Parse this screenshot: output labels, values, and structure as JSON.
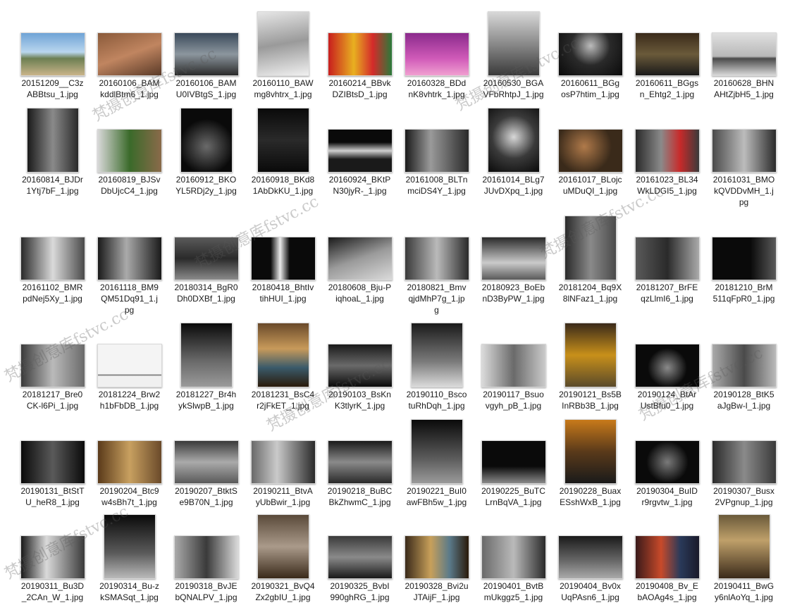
{
  "files": [
    {
      "name": "20151209__C3zABBtsu_1.jpg",
      "l1": "20151209__C3z",
      "l2": "ABBtsu_1.jpg",
      "shape": "land",
      "bg": "linear-gradient(180deg,#6fa3d6 0%,#b9d6ee 45%,#6c7f52 60%,#c9b48a 100%)"
    },
    {
      "name": "20160106_BAMkddlBtm6_1.jpg",
      "l1": "20160106_BAM",
      "l2": "kddlBtm6_1.jpg",
      "shape": "land",
      "bg": "linear-gradient(160deg,#8a5a3a,#c08560 50%,#5a3a28)"
    },
    {
      "name": "20160106_BAMU0IVBtgS_1.jpg",
      "l1": "20160106_BAM",
      "l2": "U0IVBtgS_1.jpg",
      "shape": "land",
      "bg": "linear-gradient(180deg,#3a4a5a,#8c969e 50%,#2a2a2a)"
    },
    {
      "name": "20160110_BAWmg8vhtrx_1.jpg",
      "l1": "20160110_BAW",
      "l2": "mg8vhtrx_1.jpg",
      "shape": "square",
      "bg": "linear-gradient(170deg,#e6e6e6,#9a9a9a 50%,#f0f0f0)"
    },
    {
      "name": "20160214_BBvkDZIBtsD_1.jpg",
      "l1": "20160214_BBvk",
      "l2": "DZIBtsD_1.jpg",
      "shape": "land",
      "bg": "linear-gradient(90deg,#c81e1e,#e8b020 40%,#d42a2a 70%,#2a7a3a)"
    },
    {
      "name": "20160328_BDdnK8vhtrk_1.jpg",
      "l1": "20160328_BDd",
      "l2": "nK8vhtrk_1.jpg",
      "shape": "land",
      "bg": "linear-gradient(180deg,#8a2a8c,#d05ab8 60%,#f0a0d0)"
    },
    {
      "name": "20160530_BGAVFbRhtpJ_1.jpg",
      "l1": "20160530_BGA",
      "l2": "VFbRhtpJ_1.jpg",
      "shape": "square",
      "bg": "linear-gradient(180deg,#d8d8d8,#8a8a8a 50%,#3a3a3a)"
    },
    {
      "name": "20160611_BGgosP7htim_1.jpg",
      "l1": "20160611_BGg",
      "l2": "osP7htim_1.jpg",
      "shape": "land",
      "bg": "radial-gradient(circle at 50% 30%,#bcbcbc,#2a2a2a 45%,#0a0a0a)"
    },
    {
      "name": "20160611_BGgsn_Ehtg2_1.jpg",
      "l1": "20160611_BGgs",
      "l2": "n_Ehtg2_1.jpg",
      "shape": "land",
      "bg": "linear-gradient(180deg,#3a2a1a,#6a5a3a 50%,#1a1a1a)"
    },
    {
      "name": "20160628_BHNAHtZjbH5_1.jpg",
      "l1": "20160628_BHN",
      "l2": "AHtZjbH5_1.jpg",
      "shape": "land",
      "bg": "linear-gradient(180deg,#e0e0e0,#b8b8b8 55%,#4a4a4a 60%,#d8d8d8)"
    },
    {
      "name": "20160814_BJDr1Ytj7bF_1.jpg",
      "l1": "20160814_BJDr",
      "l2": "1Ytj7bF_1.jpg",
      "shape": "port",
      "bg": "linear-gradient(90deg,#1a1a1a,#8a8a8a 50%,#2a2a2a)"
    },
    {
      "name": "20160819_BJSvDbUjcC4_1.jpg",
      "l1": "20160819_BJSv",
      "l2": "DbUjcC4_1.jpg",
      "shape": "land",
      "bg": "linear-gradient(90deg,#d8d8d8,#3a6a2a 50%,#8a6a4a)"
    },
    {
      "name": "20160912_BKOYL5RDj2y_1.jpg",
      "l1": "20160912_BKO",
      "l2": "YL5RDj2y_1.jpg",
      "shape": "square",
      "bg": "radial-gradient(circle at 50% 60%,#6a6a6a,#0a0a0a 60%)"
    },
    {
      "name": "20160918_BKd81AbDkKU_1.jpg",
      "l1": "20160918_BKd8",
      "l2": "1AbDkKU_1.jpg",
      "shape": "port",
      "bg": "linear-gradient(180deg,#0a0a0a,#2a2a2a 50%,#0a0a0a)"
    },
    {
      "name": "20160924_BKtPN30jyR-_1.jpg",
      "l1": "20160924_BKtP",
      "l2": "N30jyR-_1.jpg",
      "shape": "land",
      "bg": "linear-gradient(180deg,#0a0a0a 30%,#cfcfcf 50%,#1a1a1a 70%)"
    },
    {
      "name": "20161008_BLTnmciDS4Y_1.jpg",
      "l1": "20161008_BLTn",
      "l2": "mciDS4Y_1.jpg",
      "shape": "land",
      "bg": "linear-gradient(90deg,#1a1a1a,#9a9a9a 40%,#2a2a2a)"
    },
    {
      "name": "20161014_BLg7JUvDXpq_1.jpg",
      "l1": "20161014_BLg7",
      "l2": "JUvDXpq_1.jpg",
      "shape": "square",
      "bg": "radial-gradient(circle at 50% 45%,#d8d8d8,#3a3a3a 50%,#0a0a0a)"
    },
    {
      "name": "20161017_BLojcuMDuQI_1.jpg",
      "l1": "20161017_BLojc",
      "l2": "uMDuQI_1.jpg",
      "shape": "land",
      "bg": "radial-gradient(circle at 40% 40%,#b07a4a,#3a2a1a 60%)"
    },
    {
      "name": "20161023_BL34WkLDGI5_1.jpg",
      "l1": "20161023_BL34",
      "l2": "WkLDGI5_1.jpg",
      "shape": "land",
      "bg": "linear-gradient(90deg,#2a2a2a,#8a8a8a 40%,#c82a2a 70%,#3a3a3a)"
    },
    {
      "name": "20161031_BMOkQVDDvMH_1.jpg",
      "l1": "20161031_BMO",
      "l2": "kQVDDvMH_1.j",
      "l3": "pg",
      "shape": "land",
      "bg": "linear-gradient(90deg,#4a4a4a,#bcbcbc 50%,#2a2a2a)"
    },
    {
      "name": "20161102_BMRpdNej5Xy_1.jpg",
      "l1": "20161102_BMR",
      "l2": "pdNej5Xy_1.jpg",
      "shape": "land",
      "bg": "linear-gradient(90deg,#2a2a2a,#dadada 50%,#4a4a4a)"
    },
    {
      "name": "20161118_BM9QM51Dq91_1.jpg",
      "l1": "20161118_BM9",
      "l2": "QM51Dq91_1.j",
      "l3": "pg",
      "shape": "land",
      "bg": "linear-gradient(90deg,#1a1a1a,#aaaaaa 45%,#1a1a1a)"
    },
    {
      "name": "20180314_BgR0Dh0DXBf_1.jpg",
      "l1": "20180314_BgR0",
      "l2": "Dh0DXBf_1.jpg",
      "shape": "land",
      "bg": "linear-gradient(180deg,#5a5a5a,#2a2a2a 50%,#8a8a8a)"
    },
    {
      "name": "20180418_BhtIvtihHUI_1.jpg",
      "l1": "20180418_BhtIv",
      "l2": "tihHUI_1.jpg",
      "shape": "land",
      "bg": "linear-gradient(90deg,#0a0a0a 30%,#eaeaea 45%,#0a0a0a 60%)"
    },
    {
      "name": "20180608_Bju-PiqhoaL_1.jpg",
      "l1": "20180608_Bju-P",
      "l2": "iqhoaL_1.jpg",
      "shape": "land",
      "bg": "linear-gradient(160deg,#1a1a1a,#9a9a9a 50%,#dadada)"
    },
    {
      "name": "20180821_BmvqjdMhP7g_1.jpg",
      "l1": "20180821_Bmv",
      "l2": "qjdMhP7g_1.jp",
      "l3": "g",
      "shape": "land",
      "bg": "linear-gradient(90deg,#3a3a3a,#bababa 50%,#2a2a2a)"
    },
    {
      "name": "20180923_BoEbnD3ByPW_1.jpg",
      "l1": "20180923_BoEb",
      "l2": "nD3ByPW_1.jpg",
      "shape": "land",
      "bg": "linear-gradient(180deg,#2a2a2a,#cacaca 60%,#5a5a5a)"
    },
    {
      "name": "20181204_Bq9X8lNFaz1_1.jpg",
      "l1": "20181204_Bq9X",
      "l2": "8lNFaz1_1.jpg",
      "shape": "square",
      "bg": "linear-gradient(90deg,#2a2a2a,#8a8a8a 50%,#4a4a4a)"
    },
    {
      "name": "20181207_BrFEqzLlmI6_1.jpg",
      "l1": "20181207_BrFE",
      "l2": "qzLlmI6_1.jpg",
      "shape": "land",
      "bg": "linear-gradient(90deg,#5a5a5a,#2a2a2a 50%,#aaaaaa)"
    },
    {
      "name": "20181210_BrM511qFpR0_1.jpg",
      "l1": "20181210_BrM",
      "l2": "511qFpR0_1.jpg",
      "shape": "land",
      "bg": "linear-gradient(90deg,#0a0a0a 60%,#5a5a5a)"
    },
    {
      "name": "20181217_Bre0CK-l6Pi_1.jpg",
      "l1": "20181217_Bre0",
      "l2": "CK-l6Pi_1.jpg",
      "shape": "land",
      "bg": "linear-gradient(90deg,#3a3a3a,#bababa 50%,#6a6a6a)"
    },
    {
      "name": "20181224_Brw2h1bFbDB_1.jpg",
      "l1": "20181224_Brw2",
      "l2": "h1bFbDB_1.jpg",
      "shape": "land",
      "bg": "linear-gradient(180deg,#f4f4f4 70%,#6a6a6a 72%,#f0f0f0 75%)"
    },
    {
      "name": "20181227_Br4hykSlwpB_1.jpg",
      "l1": "20181227_Br4h",
      "l2": "ykSlwpB_1.jpg",
      "shape": "port",
      "bg": "linear-gradient(180deg,#0a0a0a,#6a6a6a 60%,#9a9a9a)"
    },
    {
      "name": "20181231_BsC4r2jFkET_1.jpg",
      "l1": "20181231_BsC4",
      "l2": "r2jFkET_1.jpg",
      "shape": "port",
      "bg": "linear-gradient(180deg,#6a4a2a,#c89a5a 40%,#3a5a6a 70%,#2a1a0a)"
    },
    {
      "name": "20190103_BsKnK3tlyrK_1.jpg",
      "l1": "20190103_BsKn",
      "l2": "K3tlyrK_1.jpg",
      "shape": "land",
      "bg": "linear-gradient(180deg,#1a1a1a,#6a6a6a 50%,#0a0a0a)"
    },
    {
      "name": "20190110_BscotuRhDqh_1.jpg",
      "l1": "20190110_Bsco",
      "l2": "tuRhDqh_1.jpg",
      "shape": "square",
      "bg": "linear-gradient(180deg,#1a1a1a,#7a7a7a 60%,#dadada)"
    },
    {
      "name": "20190117_Bsuovgyh_pB_1.jpg",
      "l1": "20190117_Bsuo",
      "l2": "vgyh_pB_1.jpg",
      "shape": "land",
      "bg": "linear-gradient(90deg,#dadada,#6a6a6a 50%,#cacaca)"
    },
    {
      "name": "20190121_Bs5BInRBb3B_1.jpg",
      "l1": "20190121_Bs5B",
      "l2": "InRBb3B_1.jpg",
      "shape": "port",
      "bg": "linear-gradient(180deg,#3a2a1a,#c8901a 50%,#5a4a2a)"
    },
    {
      "name": "20190124_BtArUstBfu0_1.jpg",
      "l1": "20190124_BtAr",
      "l2": "UstBfu0_1.jpg",
      "shape": "land",
      "bg": "radial-gradient(circle at 50% 55%,#8a8a8a,#0a0a0a 50%)"
    },
    {
      "name": "20190128_BtK5aJgBw-l_1.jpg",
      "l1": "20190128_BtK5",
      "l2": "aJgBw-l_1.jpg",
      "shape": "land",
      "bg": "linear-gradient(90deg,#aaaaaa,#4a4a4a 50%,#bababa)"
    },
    {
      "name": "20190131_BtStTU_heR8_1.jpg",
      "l1": "20190131_BtStT",
      "l2": "U_heR8_1.jpg",
      "shape": "land",
      "bg": "linear-gradient(90deg,#0a0a0a,#5a5a5a 50%,#0a0a0a)"
    },
    {
      "name": "20190204_Btc9w4sBh7t_1.jpg",
      "l1": "20190204_Btc9",
      "l2": "w4sBh7t_1.jpg",
      "shape": "land",
      "bg": "linear-gradient(90deg,#5a3a1a,#c8a060 50%,#6a4a2a)"
    },
    {
      "name": "20190207_BtktSe9B70N_1.jpg",
      "l1": "20190207_BtktS",
      "l2": "e9B70N_1.jpg",
      "shape": "land",
      "bg": "linear-gradient(180deg,#3a3a3a,#aaaaaa 50%,#5a5a5a)"
    },
    {
      "name": "20190211_BtvAyUbBwir_1.jpg",
      "l1": "20190211_BtvA",
      "l2": "yUbBwir_1.jpg",
      "shape": "land",
      "bg": "linear-gradient(90deg,#6a6a6a,#cacaca 40%,#2a2a2a)"
    },
    {
      "name": "20190218_BuBCBkZhwmC_1.jpg",
      "l1": "20190218_BuBC",
      "l2": "BkZhwmC_1.jpg",
      "shape": "land",
      "bg": "linear-gradient(180deg,#1a1a1a,#8a8a8a 50%,#2a2a2a)"
    },
    {
      "name": "20190221_BuI0awFBh5w_1.jpg",
      "l1": "20190221_BuI0",
      "l2": "awFBh5w_1.jpg",
      "shape": "square",
      "bg": "linear-gradient(180deg,#0a0a0a,#5a5a5a 60%,#9a9a9a)"
    },
    {
      "name": "20190225_BuTCLrnBqVA_1.jpg",
      "l1": "20190225_BuTC",
      "l2": "LrnBqVA_1.jpg",
      "shape": "land",
      "bg": "linear-gradient(180deg,#0a0a0a 60%,#8a8a8a)"
    },
    {
      "name": "20190228_BuaxESshWxB_1.jpg",
      "l1": "20190228_Buax",
      "l2": "ESshWxB_1.jpg",
      "shape": "port",
      "bg": "linear-gradient(180deg,#c87a1a,#5a3a1a 50%,#1a1a1a)"
    },
    {
      "name": "20190304_BuIDr9rgvtw_1.jpg",
      "l1": "20190304_BuID",
      "l2": "r9rgvtw_1.jpg",
      "shape": "land",
      "bg": "radial-gradient(circle at 50% 50%,#7a7a7a,#0a0a0a 55%)"
    },
    {
      "name": "20190307_Busx2VPgnup_1.jpg",
      "l1": "20190307_Busx",
      "l2": "2VPgnup_1.jpg",
      "shape": "land",
      "bg": "linear-gradient(90deg,#2a2a2a,#8a8a8a 50%,#3a3a3a)"
    },
    {
      "name": "20190311_Bu3D_2CAn_W_1.jpg",
      "l1": "20190311_Bu3D",
      "l2": "_2CAn_W_1.jpg",
      "shape": "land",
      "bg": "linear-gradient(90deg,#1a1a1a,#dadada 40%,#3a3a3a)"
    },
    {
      "name": "20190314_Bu-zkSMASqt_1.jpg",
      "l1": "20190314_Bu-z",
      "l2": "kSMASqt_1.jpg",
      "shape": "square",
      "bg": "linear-gradient(180deg,#0a0a0a,#5a5a5a 60%,#bababa)"
    },
    {
      "name": "20190318_BvJEbQNALPV_1.jpg",
      "l1": "20190318_BvJE",
      "l2": "bQNALPV_1.jpg",
      "shape": "land",
      "bg": "linear-gradient(90deg,#aaaaaa,#3a3a3a 50%,#dadada)"
    },
    {
      "name": "20190321_BvQ4Zx2gbIU_1.jpg",
      "l1": "20190321_BvQ4",
      "l2": "Zx2gbIU_1.jpg",
      "shape": "port",
      "bg": "linear-gradient(180deg,#5a4a3a,#aa9a8a 50%,#3a2a1a)"
    },
    {
      "name": "20190325_BvbI990ghRG_1.jpg",
      "l1": "20190325_BvbI",
      "l2": "990ghRG_1.jpg",
      "shape": "land",
      "bg": "linear-gradient(180deg,#3a3a3a,#8a8a8a 50%,#1a1a1a)"
    },
    {
      "name": "20190328_Bvi2uJTAijF_1.jpg",
      "l1": "20190328_Bvi2u",
      "l2": "JTAijF_1.jpg",
      "shape": "land",
      "bg": "linear-gradient(90deg,#3a2a1a,#c8a05a 40%,#5a7a8a 70%,#2a1a0a)"
    },
    {
      "name": "20190401_BvtBmUkggz5_1.jpg",
      "l1": "20190401_BvtB",
      "l2": "mUkggz5_1.jpg",
      "shape": "land",
      "bg": "linear-gradient(90deg,#6a6a6a,#bababa 50%,#2a2a2a)"
    },
    {
      "name": "20190404_Bv0xUqPAsn6_1.jpg",
      "l1": "20190404_Bv0x",
      "l2": "UqPAsn6_1.jpg",
      "shape": "land",
      "bg": "linear-gradient(180deg,#1a1a1a,#6a6a6a 60%,#aaaaaa)"
    },
    {
      "name": "20190408_Bv_EbAOAg4s_1.jpg",
      "l1": "20190408_Bv_E",
      "l2": "bAOAg4s_1.jpg",
      "shape": "land",
      "bg": "linear-gradient(90deg,#3a1a1a,#c84a2a 40%,#2a3a5a 70%,#1a1a2a)"
    },
    {
      "name": "20190411_BwGy6nlAoYq_1.jpg",
      "l1": "20190411_BwG",
      "l2": "y6nlAoYq_1.jpg",
      "shape": "port",
      "bg": "linear-gradient(180deg,#6a5a3a,#bfa06a 40%,#3a2a1a)"
    }
  ],
  "watermarks": [
    {
      "text": "梵摄创意库fstvc.cc"
    },
    {
      "text": "梵摄创意库fstvc.cc"
    },
    {
      "text": "梵摄创意库fstvc.cc"
    },
    {
      "text": "梵摄创意库fstvc.cc"
    },
    {
      "text": "梵摄创意库fstvc.cc"
    },
    {
      "text": "梵摄创意库fstvc.cc"
    },
    {
      "text": "梵摄创意库fstvc.cc"
    },
    {
      "text": "梵摄创意库fstvc.cc"
    }
  ]
}
